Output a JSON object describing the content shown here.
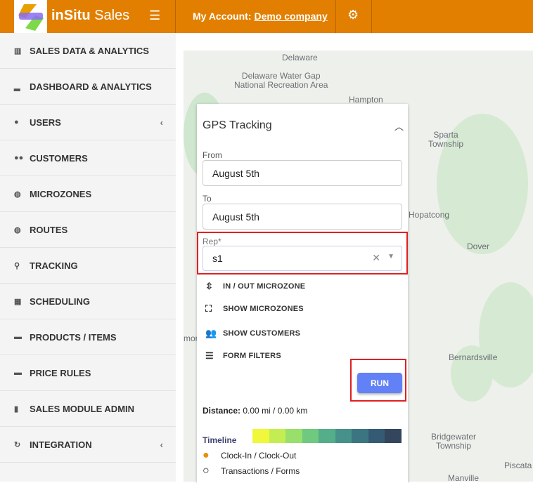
{
  "header": {
    "brand_bold": "inSitu",
    "brand_rest": " Sales",
    "account_label": "My Account:",
    "account_name": "Demo company"
  },
  "sidebar": {
    "items": [
      {
        "label": "SALES DATA & ANALYTICS",
        "icon": "bar-chart-icon",
        "glyph": "▥"
      },
      {
        "label": "DASHBOARD & ANALYTICS",
        "icon": "signal-icon",
        "glyph": "▂"
      },
      {
        "label": "USERS",
        "icon": "user-icon",
        "glyph": "●",
        "chevron": "‹"
      },
      {
        "label": "CUSTOMERS",
        "icon": "users-icon",
        "glyph": "●●"
      },
      {
        "label": "MICROZONES",
        "icon": "globe-icon",
        "glyph": "◍"
      },
      {
        "label": "ROUTES",
        "icon": "globe-icon",
        "glyph": "◍"
      },
      {
        "label": "TRACKING",
        "icon": "map-marker-icon",
        "glyph": "⚲"
      },
      {
        "label": "SCHEDULING",
        "icon": "calendar-icon",
        "glyph": "▦"
      },
      {
        "label": "PRODUCTS / ITEMS",
        "icon": "briefcase-icon",
        "glyph": "▬"
      },
      {
        "label": "PRICE RULES",
        "icon": "briefcase-icon",
        "glyph": "▬"
      },
      {
        "label": "SALES MODULE ADMIN",
        "icon": "suitcase-icon",
        "glyph": "▮"
      },
      {
        "label": "INTEGRATION",
        "icon": "refresh-icon",
        "glyph": "↻",
        "chevron": "‹"
      }
    ]
  },
  "map": {
    "labels": [
      "Delaware",
      "Delaware Water Gap\nNational Recreation Area",
      "Hampton",
      "Sparta\nTownship",
      "Hopatcong",
      "Dover",
      "Bernardsville",
      "Bridgewater\nTownship",
      "Manville",
      "Piscata",
      "mon"
    ]
  },
  "panel": {
    "title": "GPS Tracking",
    "from_label": "From",
    "from_value": "August 5th",
    "to_label": "To",
    "to_value": "August 5th",
    "rep_label": "Rep*",
    "rep_value": "s1",
    "options": [
      "IN / OUT MICROZONE",
      "SHOW MICROZONES",
      "SHOW CUSTOMERS",
      "FORM FILTERS"
    ],
    "run_label": "RUN",
    "distance_label": "Distance:",
    "distance_value": "0.00 mi / 0.00 km",
    "timeline_label": "Timeline",
    "timeline_colors": [
      "#f1f73a",
      "#c3ed52",
      "#98df6c",
      "#6fc97e",
      "#55ae8a",
      "#47918b",
      "#3c7582",
      "#355b74",
      "#33465e"
    ],
    "legend": [
      "Clock-In / Clock-Out",
      "Transactions / Forms"
    ]
  }
}
